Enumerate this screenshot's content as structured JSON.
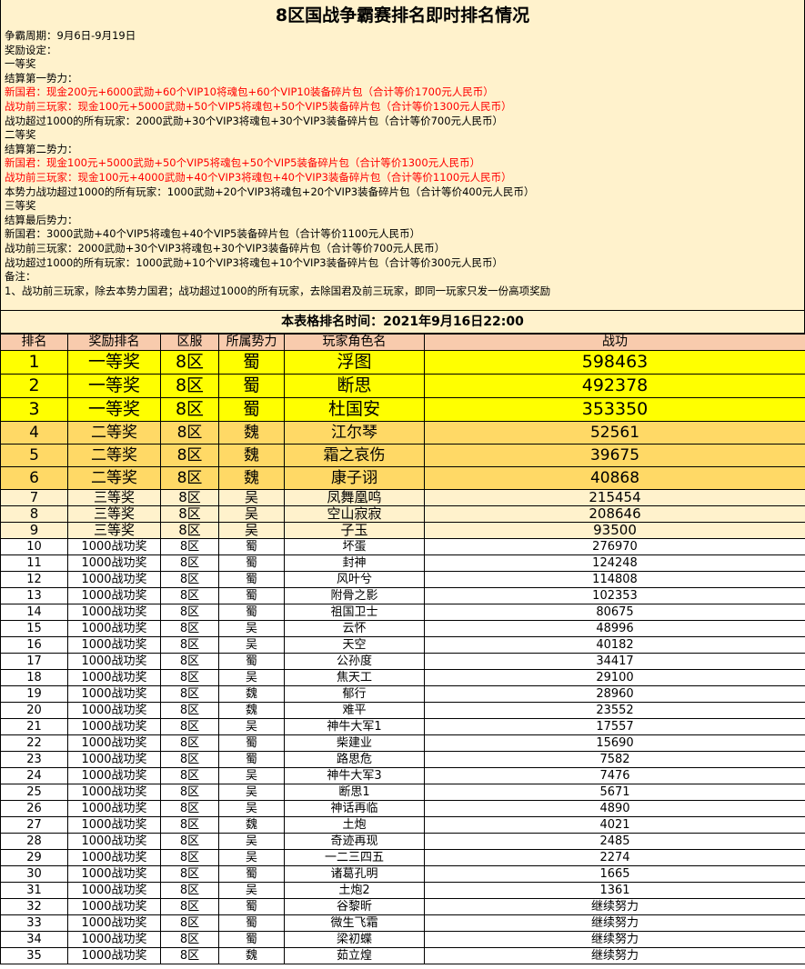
{
  "title": "8区国战争霸赛排名即时排名情况",
  "info_lines": [
    {
      "text": "争霸周期：9月6日-9月19日",
      "red": false
    },
    {
      "text": "奖励设定：",
      "red": false
    },
    {
      "text": "一等奖",
      "red": false
    },
    {
      "text": "结算第一势力：",
      "red": false
    },
    {
      "text": "新国君：现金200元+6000武勋+60个VIP10将魂包+60个VIP10装备碎片包（合计等价1700元人民币）",
      "red": true
    },
    {
      "text": "战功前三玩家：现金100元+5000武勋+50个VIP5将魂包+50个VIP5装备碎片包（合计等价1300元人民币）",
      "red": true
    },
    {
      "text": "战功超过1000的所有玩家：2000武勋+30个VIP3将魂包+30个VIP3装备碎片包（合计等价700元人民币）",
      "red": false
    },
    {
      "text": "二等奖",
      "red": false
    },
    {
      "text": "结算第二势力：",
      "red": false
    },
    {
      "text": "新国君：现金100元+5000武勋+50个VIP5将魂包+50个VIP5装备碎片包（合计等价1300元人民币）",
      "red": true
    },
    {
      "text": "战功前三玩家：现金100元+4000武勋+40个VIP3将魂包+40个VIP3装备碎片包（合计等价1100元人民币）",
      "red": true
    },
    {
      "text": "本势力战功超过1000的所有玩家：1000武勋+20个VIP3将魂包+20个VIP3装备碎片包（合计等价400元人民币）",
      "red": false
    },
    {
      "text": "三等奖",
      "red": false
    },
    {
      "text": "结算最后势力：",
      "red": false
    },
    {
      "text": "新国君：3000武勋+40个VIP5将魂包+40个VIP5装备碎片包（合计等价1100元人民币）",
      "red": false
    },
    {
      "text": "战功前三玩家：2000武勋+30个VIP3将魂包+30个VIP3装备碎片包（合计等价700元人民币）",
      "red": false
    },
    {
      "text": "战功超过1000的所有玩家：1000武勋+10个VIP3将魂包+10个VIP3装备碎片包（合计等价300元人民币）",
      "red": false
    },
    {
      "text": "备注：",
      "red": false
    },
    {
      "text": "1、战功前三玩家，除去本势力国君；战功超过1000的所有玩家，去除国君及前三玩家，即同一玩家只发一份高项奖励",
      "red": false
    }
  ],
  "table_time": "本表格排名时间：2021年9月16日22:00",
  "columns": [
    "排名",
    "奖励排名",
    "区服",
    "所属势力",
    "玩家角色名",
    "战功"
  ],
  "rows": [
    {
      "tier": 1,
      "cells": [
        "1",
        "一等奖",
        "8区",
        "蜀",
        "浮图",
        "598463"
      ]
    },
    {
      "tier": 1,
      "cells": [
        "2",
        "一等奖",
        "8区",
        "蜀",
        "断思",
        "492378"
      ]
    },
    {
      "tier": 1,
      "cells": [
        "3",
        "一等奖",
        "8区",
        "蜀",
        "杜国安",
        "353350"
      ]
    },
    {
      "tier": 2,
      "cells": [
        "4",
        "二等奖",
        "8区",
        "魏",
        "江尔琴",
        "52561"
      ]
    },
    {
      "tier": 2,
      "cells": [
        "5",
        "二等奖",
        "8区",
        "魏",
        "霜之哀伤",
        "39675"
      ]
    },
    {
      "tier": 2,
      "cells": [
        "6",
        "二等奖",
        "8区",
        "魏",
        "康子诩",
        "40868"
      ]
    },
    {
      "tier": 3,
      "cells": [
        "7",
        "三等奖",
        "8区",
        "吴",
        "凤舞凰鸣",
        "215454"
      ]
    },
    {
      "tier": 3,
      "cells": [
        "8",
        "三等奖",
        "8区",
        "吴",
        "空山寂寂",
        "208646"
      ]
    },
    {
      "tier": 3,
      "cells": [
        "9",
        "三等奖",
        "8区",
        "吴",
        "子玉",
        "93500"
      ]
    },
    {
      "tier": 4,
      "cells": [
        "10",
        "1000战功奖",
        "8区",
        "蜀",
        "坏蛋",
        "276970"
      ]
    },
    {
      "tier": 4,
      "cells": [
        "11",
        "1000战功奖",
        "8区",
        "蜀",
        "封神",
        "124248"
      ]
    },
    {
      "tier": 4,
      "cells": [
        "12",
        "1000战功奖",
        "8区",
        "蜀",
        "风叶兮",
        "114808"
      ]
    },
    {
      "tier": 4,
      "cells": [
        "13",
        "1000战功奖",
        "8区",
        "蜀",
        "附骨之影",
        "102353"
      ]
    },
    {
      "tier": 4,
      "cells": [
        "14",
        "1000战功奖",
        "8区",
        "蜀",
        "祖国卫士",
        "80675"
      ]
    },
    {
      "tier": 4,
      "cells": [
        "15",
        "1000战功奖",
        "8区",
        "吴",
        "云怀",
        "48996"
      ]
    },
    {
      "tier": 4,
      "cells": [
        "16",
        "1000战功奖",
        "8区",
        "吴",
        "天空",
        "40182"
      ]
    },
    {
      "tier": 4,
      "cells": [
        "17",
        "1000战功奖",
        "8区",
        "蜀",
        "公孙度",
        "34417"
      ]
    },
    {
      "tier": 4,
      "cells": [
        "18",
        "1000战功奖",
        "8区",
        "吴",
        "焦天工",
        "29100"
      ]
    },
    {
      "tier": 4,
      "cells": [
        "19",
        "1000战功奖",
        "8区",
        "魏",
        "郁行",
        "28960"
      ]
    },
    {
      "tier": 4,
      "cells": [
        "20",
        "1000战功奖",
        "8区",
        "魏",
        "难平",
        "23552"
      ]
    },
    {
      "tier": 4,
      "cells": [
        "21",
        "1000战功奖",
        "8区",
        "吴",
        "神牛大军1",
        "17557"
      ]
    },
    {
      "tier": 4,
      "cells": [
        "22",
        "1000战功奖",
        "8区",
        "蜀",
        "柴建业",
        "15690"
      ]
    },
    {
      "tier": 4,
      "cells": [
        "23",
        "1000战功奖",
        "8区",
        "蜀",
        "路思危",
        "7582"
      ]
    },
    {
      "tier": 4,
      "cells": [
        "24",
        "1000战功奖",
        "8区",
        "吴",
        "神牛大军3",
        "7476"
      ]
    },
    {
      "tier": 4,
      "cells": [
        "25",
        "1000战功奖",
        "8区",
        "吴",
        "断思1",
        "5671"
      ]
    },
    {
      "tier": 4,
      "cells": [
        "26",
        "1000战功奖",
        "8区",
        "吴",
        "神话再临",
        "4890"
      ]
    },
    {
      "tier": 4,
      "cells": [
        "27",
        "1000战功奖",
        "8区",
        "魏",
        "土炮",
        "4021"
      ]
    },
    {
      "tier": 4,
      "cells": [
        "28",
        "1000战功奖",
        "8区",
        "吴",
        "奇迹再现",
        "2485"
      ]
    },
    {
      "tier": 4,
      "cells": [
        "29",
        "1000战功奖",
        "8区",
        "吴",
        "一二三四五",
        "2274"
      ]
    },
    {
      "tier": 4,
      "cells": [
        "30",
        "1000战功奖",
        "8区",
        "蜀",
        "诸葛孔明",
        "1665"
      ]
    },
    {
      "tier": 4,
      "cells": [
        "31",
        "1000战功奖",
        "8区",
        "吴",
        "土炮2",
        "1361"
      ]
    },
    {
      "tier": 4,
      "cells": [
        "32",
        "1000战功奖",
        "8区",
        "蜀",
        "谷黎昕",
        "继续努力"
      ]
    },
    {
      "tier": 4,
      "cells": [
        "33",
        "1000战功奖",
        "8区",
        "蜀",
        "微生飞霜",
        "继续努力"
      ]
    },
    {
      "tier": 4,
      "cells": [
        "34",
        "1000战功奖",
        "8区",
        "蜀",
        "梁初蝶",
        "继续努力"
      ]
    },
    {
      "tier": 4,
      "cells": [
        "35",
        "1000战功奖",
        "8区",
        "魏",
        "茹立煌",
        "继续努力"
      ]
    }
  ]
}
